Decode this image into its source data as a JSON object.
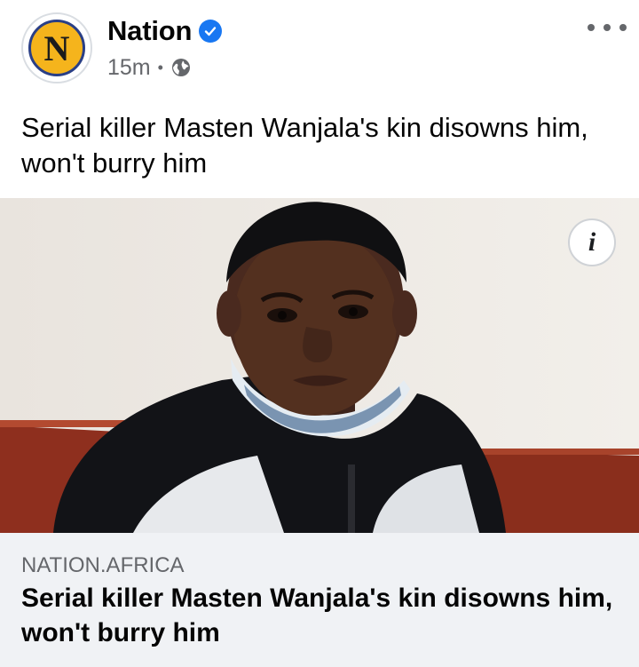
{
  "post": {
    "page_name": "Nation",
    "avatar_letter": "N",
    "timestamp": "15m",
    "separator": "•",
    "privacy_icon": "globe-icon",
    "more_icon": "more-horizontal-icon",
    "verified_icon": "verified-badge-icon",
    "text": "Serial killer Masten Wanjala's kin disowns him, won't burry him"
  },
  "link_preview": {
    "info_label": "i",
    "domain": "NATION.AFRICA",
    "title": "Serial killer Masten Wanjala's kin disowns him, won't burry him"
  },
  "colors": {
    "brand_yellow": "#f5b41c",
    "brand_navy": "#2a3f86",
    "verified_blue": "#1877f2",
    "meta_gray": "#65676b",
    "footer_bg": "#f0f2f5"
  }
}
